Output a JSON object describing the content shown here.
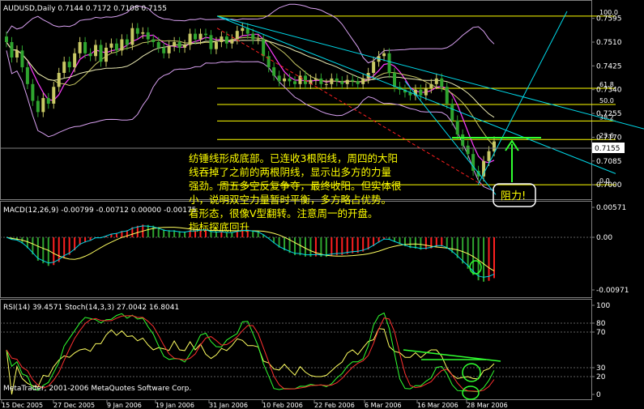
{
  "colors": {
    "background": "#000000",
    "grid": "#808080",
    "bull": "#C8C864",
    "bear": "#2FA52F",
    "fib": "#FFFF00",
    "trend": "#00D8E8",
    "bollinger": "#D8A0F0",
    "ma_fast": "#FF3CFF",
    "ma_slow": "#E8E8B0",
    "dashed": "#FF2020",
    "macd_up": "#FF2020",
    "macd_down": "#2FA52F",
    "macd_signal": "#FFFF60",
    "annotation_text": "#FFFF00",
    "resistance_box": "#FFFFFF",
    "resistance_text": "#FFFF00",
    "arrow": "#30FF30",
    "rsi": "#30FF30",
    "stoch_main": "#FFFF60",
    "stoch_signal": "#FF3030",
    "rsi_green_line": "#30FF30"
  },
  "chart_data": [
    {
      "type": "candlestick",
      "title": "AUDUSD,Daily  0.7144 0.7172 0.7108 0.7155",
      "current_price_label": "0.7155",
      "ylim": [
        0.696,
        0.762
      ],
      "y_ticks": [
        "0.7595",
        "0.7510",
        "0.7425",
        "0.7340",
        "0.7255",
        "0.7170",
        "0.7085",
        "0.7000"
      ],
      "y_tick_values": [
        0.7595,
        0.751,
        0.7425,
        0.734,
        0.7255,
        0.717,
        0.7085,
        0.7
      ],
      "fibonacci": [
        {
          "label": "100.0",
          "value": 0.7603
        },
        {
          "label": "61.8",
          "value": 0.7345
        },
        {
          "label": "50.0",
          "value": 0.7287
        },
        {
          "label": "38.2",
          "value": 0.7228
        },
        {
          "label": "23.6",
          "value": 0.7162
        },
        {
          "label": "0.0",
          "value": 0.7
        }
      ],
      "closes": [
        0.751,
        0.7455,
        0.748,
        0.742,
        0.736,
        0.73,
        0.726,
        0.731,
        0.729,
        0.735,
        0.74,
        0.744,
        0.742,
        0.747,
        0.751,
        0.747,
        0.746,
        0.75,
        0.744,
        0.749,
        0.7505,
        0.748,
        0.752,
        0.75,
        0.756,
        0.754,
        0.7545,
        0.752,
        0.751,
        0.749,
        0.747,
        0.7495,
        0.751,
        0.749,
        0.75,
        0.754,
        0.752,
        0.754,
        0.7535,
        0.7485,
        0.751,
        0.753,
        0.7505,
        0.752,
        0.755,
        0.756,
        0.754,
        0.752,
        0.752,
        0.746,
        0.742,
        0.739,
        0.737,
        0.738,
        0.737,
        0.736,
        0.739,
        0.736,
        0.7375,
        0.738,
        0.736,
        0.736,
        0.738,
        0.737,
        0.736,
        0.7375,
        0.737,
        0.736,
        0.738,
        0.74,
        0.744,
        0.746,
        0.747,
        0.74,
        0.735,
        0.734,
        0.733,
        0.732,
        0.734,
        0.732,
        0.7345,
        0.736,
        0.738,
        0.735,
        0.729,
        0.723,
        0.718,
        0.714,
        0.711,
        0.705,
        0.703,
        0.7085,
        0.712,
        0.7155
      ]
    },
    {
      "type": "macd",
      "title": "MACD(12,26,9) -0.00799 -0.00712 0.00000 -0.00175",
      "y_ticks": [
        "0.00571",
        "0.00",
        "-0.00971"
      ]
    },
    {
      "type": "rsi_stoch",
      "title": "RSI(14) 39.4571  Stoch(14,3,3) 27.0042 16.8041",
      "y_ticks": [
        "100",
        "80",
        "70",
        "30",
        "20",
        "0"
      ]
    }
  ],
  "x_labels": [
    "15 Dec 2005",
    "27 Dec 2005",
    "9 Jan 2006",
    "19 Jan 2006",
    "31 Jan 2006",
    "10 Feb 2006",
    "22 Feb 2006",
    "6 Mar 2006",
    "16 Mar 2006",
    "28 Mar 2006"
  ],
  "annotation_lines": [
    "纺锤线形成底部。已连收3根阳线，周四的大阳",
    "线吞掉了之前的两根阴线，显示出多方的力量",
    "强劲。周五多空反复争夺，最终收阳。但实体很",
    "小，说明双空力量暂时平衡，多方略占优势。",
    "看形态，很像V型翻转。注意周一的开盘。",
    "指标探底回升"
  ],
  "resistance_label": "阻力!",
  "copyright": "MetaTrader,  2001-2006 MetaQuotes Software Corp."
}
